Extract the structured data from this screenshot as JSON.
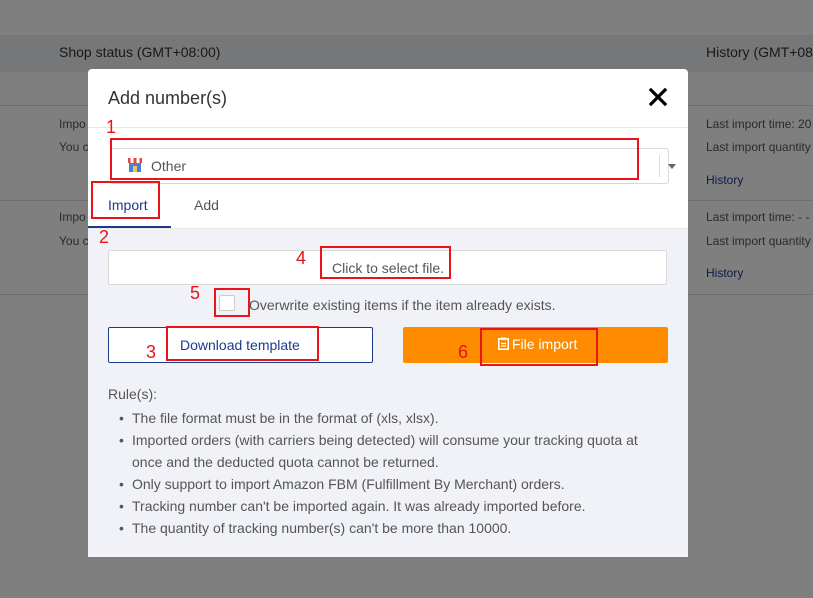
{
  "background": {
    "shop_status_header": "Shop status (GMT+08:00)",
    "history_header": "History (GMT+08",
    "row1_left1": "Impo",
    "row1_left2": "You c",
    "row1_right1": "Last import time: 20",
    "row1_right2": "Last import quantity",
    "row1_history": "History",
    "row2_left1": "Impo",
    "row2_left2": "You c",
    "row2_right1": "Last import time: - -",
    "row2_right2": "Last import quantity",
    "row2_history": "History"
  },
  "modal": {
    "title": "Add number(s)",
    "close_icon": "close-icon",
    "store_select": {
      "value": "Other",
      "icon": "store-icon"
    },
    "tabs": [
      {
        "label": "Import",
        "active": true
      },
      {
        "label": "Add",
        "active": false
      }
    ],
    "file_input": {
      "placeholder": "Click to select file."
    },
    "overwrite_checkbox": {
      "label": "Overwrite existing items if the item already exists.",
      "checked": false
    },
    "download_button": "Download template",
    "import_button": {
      "label": "File import",
      "icon": "clipboard-icon"
    },
    "rules_title": "Rule(s):",
    "rules": [
      "The file format must be in the format of (xls, xlsx).",
      "Imported orders (with carriers being detected) will consume your tracking quota at once and the deducted quota cannot be returned.",
      "Only support to import Amazon FBM (Fulfillment By Merchant) orders.",
      "Tracking number can't be imported again. It was already imported before.",
      "The quantity of tracking number(s) can't be more than 10000."
    ]
  },
  "annotations": [
    "1",
    "2",
    "3",
    "4",
    "5",
    "6"
  ],
  "colors": {
    "accent": "#ff8c00",
    "primary": "#1a3a8a",
    "annotation": "#e8141a"
  }
}
